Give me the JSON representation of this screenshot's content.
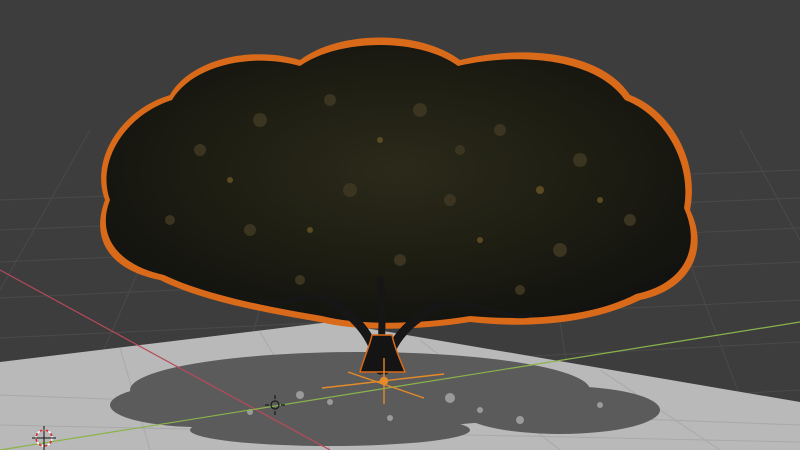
{
  "viewport": {
    "background": "#3d3d3d",
    "grid_color": "#4a4a4a",
    "plane_color": "#b9b9b9",
    "shadow_color": "#5b5b5b",
    "x_axis_color": "#b84a5c",
    "y_axis_color": "#8bb34a",
    "selection_outline_color": "#d96a1a"
  },
  "scene": {
    "objects": [
      {
        "name": "tree",
        "icon": "tree-icon",
        "selected": true
      },
      {
        "name": "ground-plane",
        "icon": "plane-icon",
        "selected": false
      },
      {
        "name": "light",
        "icon": "lamp-icon",
        "selected": false
      }
    ],
    "object_origin_marker": "orange-gizmo",
    "cursor_3d": "3d-cursor-icon"
  }
}
